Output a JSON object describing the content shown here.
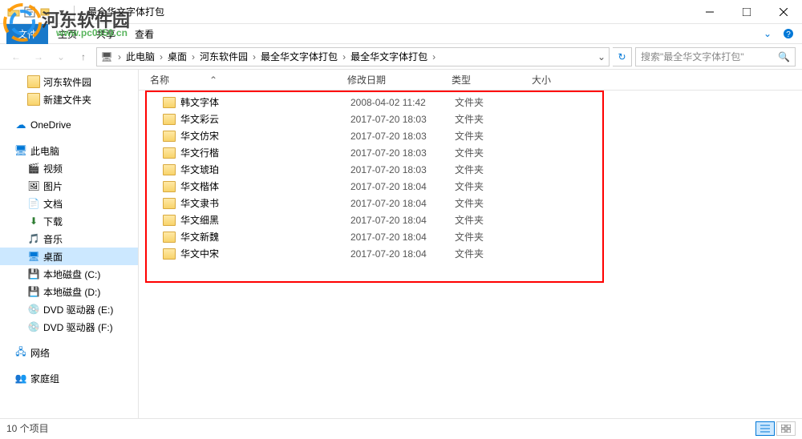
{
  "window": {
    "title": "最全华文字体打包"
  },
  "ribbon": {
    "file": "文件",
    "home": "主页",
    "share": "共享",
    "view": "查看"
  },
  "breadcrumb": {
    "items": [
      "此电脑",
      "桌面",
      "河东软件园",
      "最全华文字体打包",
      "最全华文字体打包"
    ]
  },
  "search": {
    "placeholder": "搜索\"最全华文字体打包\""
  },
  "sidebar": {
    "items": [
      {
        "label": "河东软件园",
        "icon": "folder",
        "indent": true
      },
      {
        "label": "新建文件夹",
        "icon": "folder",
        "indent": true
      },
      {
        "spacer": true
      },
      {
        "label": "OneDrive",
        "icon": "onedrive"
      },
      {
        "spacer": true
      },
      {
        "label": "此电脑",
        "icon": "pc"
      },
      {
        "label": "视频",
        "icon": "video",
        "indent": true
      },
      {
        "label": "图片",
        "icon": "picture",
        "indent": true
      },
      {
        "label": "文档",
        "icon": "doc",
        "indent": true
      },
      {
        "label": "下载",
        "icon": "download",
        "indent": true
      },
      {
        "label": "音乐",
        "icon": "music",
        "indent": true
      },
      {
        "label": "桌面",
        "icon": "desktop",
        "indent": true,
        "selected": true
      },
      {
        "label": "本地磁盘 (C:)",
        "icon": "disk",
        "indent": true
      },
      {
        "label": "本地磁盘 (D:)",
        "icon": "disk",
        "indent": true
      },
      {
        "label": "DVD 驱动器 (E:)",
        "icon": "dvd",
        "indent": true
      },
      {
        "label": "DVD 驱动器 (F:)",
        "icon": "dvd",
        "indent": true
      },
      {
        "spacer": true
      },
      {
        "label": "网络",
        "icon": "network"
      },
      {
        "spacer": true
      },
      {
        "label": "家庭组",
        "icon": "homegroup"
      }
    ]
  },
  "columns": {
    "name": "名称",
    "date": "修改日期",
    "type": "类型",
    "size": "大小"
  },
  "files": [
    {
      "name": "韩文字体",
      "date": "2008-04-02 11:42",
      "type": "文件夹"
    },
    {
      "name": "华文彩云",
      "date": "2017-07-20 18:03",
      "type": "文件夹"
    },
    {
      "name": "华文仿宋",
      "date": "2017-07-20 18:03",
      "type": "文件夹"
    },
    {
      "name": "华文行楷",
      "date": "2017-07-20 18:03",
      "type": "文件夹"
    },
    {
      "name": "华文琥珀",
      "date": "2017-07-20 18:03",
      "type": "文件夹"
    },
    {
      "name": "华文楷体",
      "date": "2017-07-20 18:04",
      "type": "文件夹"
    },
    {
      "name": "华文隶书",
      "date": "2017-07-20 18:04",
      "type": "文件夹"
    },
    {
      "name": "华文细黑",
      "date": "2017-07-20 18:04",
      "type": "文件夹"
    },
    {
      "name": "华文新魏",
      "date": "2017-07-20 18:04",
      "type": "文件夹"
    },
    {
      "name": "华文中宋",
      "date": "2017-07-20 18:04",
      "type": "文件夹"
    }
  ],
  "status": {
    "count": "10 个项目"
  },
  "watermark": {
    "text": "河东软件园",
    "url": "www.pc0359.cn"
  }
}
